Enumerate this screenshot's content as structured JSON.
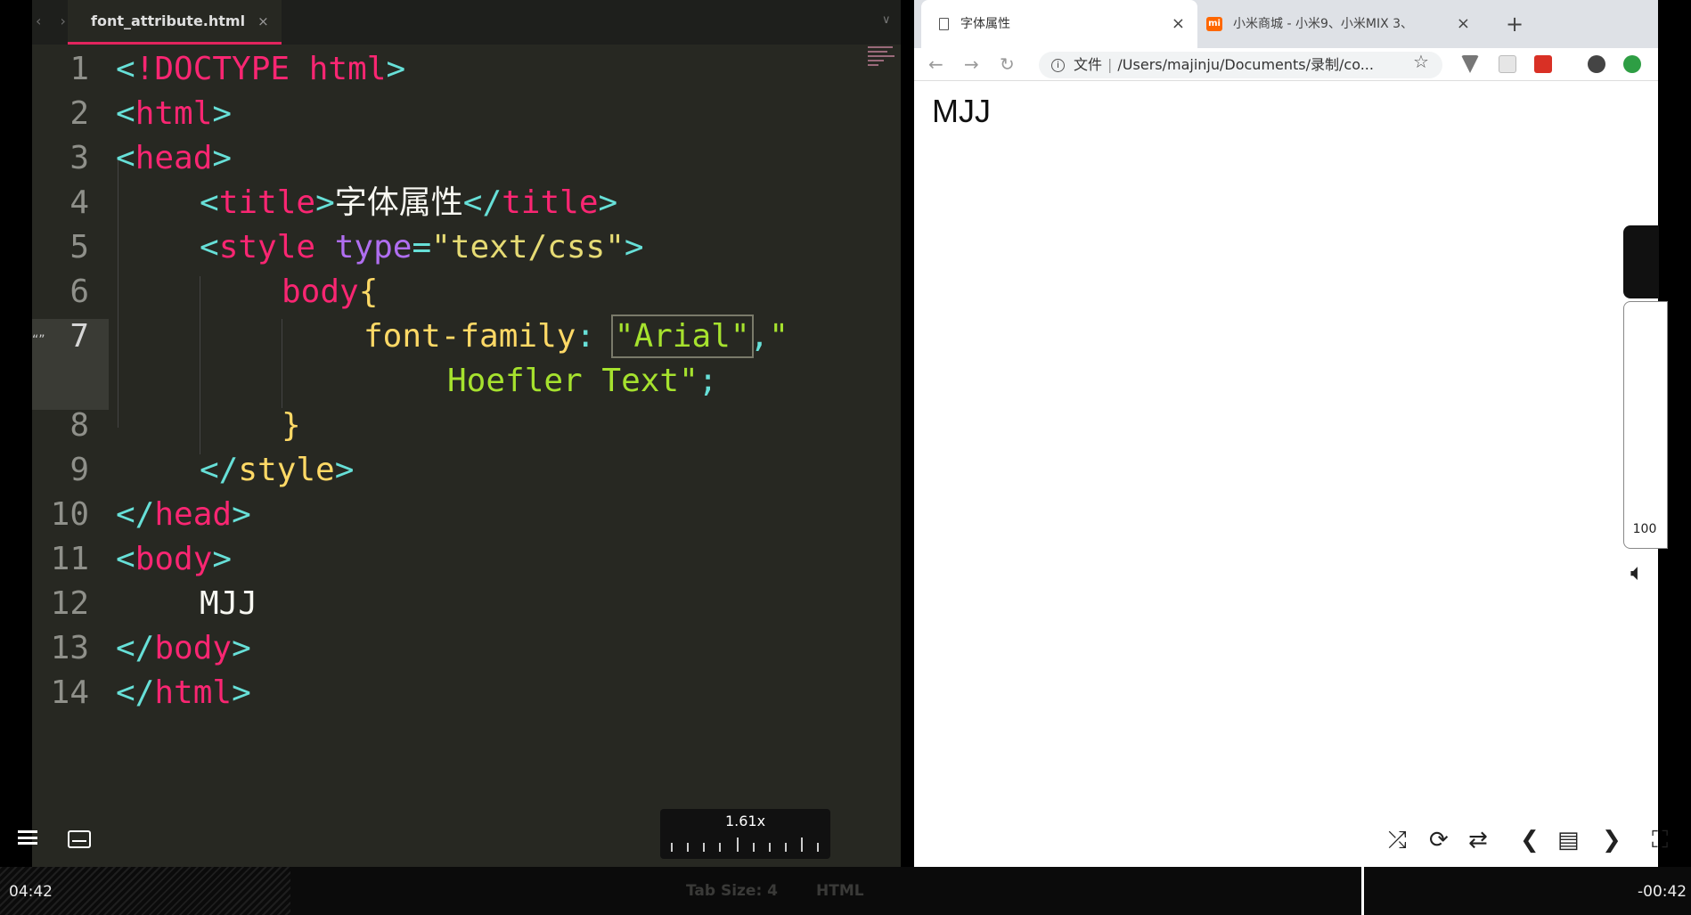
{
  "editor": {
    "tab_label": "font_attribute.html",
    "tab_close": "×",
    "nav_arrows": "‹ ›",
    "status_tab_size": "Tab Size: 4",
    "status_syntax": "HTML",
    "line_numbers": [
      "1",
      "2",
      "3",
      "4",
      "5",
      "6",
      "7",
      "8",
      "9",
      "10",
      "11",
      "12",
      "13",
      "14"
    ],
    "code": {
      "l1": {
        "open": "<",
        "tag": "!DOCTYPE html",
        "close": ">"
      },
      "l2": {
        "open": "<",
        "tag": "html",
        "close": ">"
      },
      "l3": {
        "open": "<",
        "tag": "head",
        "close": ">"
      },
      "l4": {
        "open": "<",
        "tag": "title",
        "mid": ">",
        "text": "字体属性",
        "end_open": "</",
        "end_tag": "title",
        "close": ">"
      },
      "l5": {
        "open": "<",
        "tag": "style",
        "attr": "type",
        "eq": "=",
        "val": "\"text/css\"",
        "close": ">"
      },
      "l6": {
        "sel": "body",
        "brace": "{"
      },
      "l7": {
        "prop": "font-family",
        "colon": ": ",
        "val1": "\"Arial\"",
        "comma": ",",
        "val2a": "\""
      },
      "l7b": {
        "val2b": "Hoefler Text\"",
        "semi": ";"
      },
      "l8": {
        "brace": "}"
      },
      "l9": {
        "open": "</",
        "tag": "style",
        "close": ">"
      },
      "l10": {
        "open": "</",
        "tag": "head",
        "close": ">"
      },
      "l11": {
        "open": "<",
        "tag": "body",
        "close": ">"
      },
      "l12": {
        "text": "MJJ"
      },
      "l13": {
        "open": "</",
        "tag": "body",
        "close": ">"
      },
      "l14": {
        "open": "</",
        "tag": "html",
        "close": ">"
      }
    }
  },
  "browser": {
    "active_tab": "字体属性",
    "inactive_tab": "小米商城 - 小米9、小米MIX 3、",
    "mi_logo": "mi",
    "tab_close": "×",
    "new_tab": "+",
    "address_scheme": "文件",
    "address_url": "/Users/majinju/Documents/录制/co...",
    "page_text": "MJJ",
    "icons": [
      "back-arrow-icon",
      "forward-arrow-icon",
      "reload-icon",
      "info-icon",
      "star-icon",
      "profile-icon"
    ]
  },
  "player": {
    "speed": "1.61x",
    "elapsed": "04:42",
    "remaining": "-00:42",
    "volume": "100",
    "accent": "#e2245e"
  }
}
